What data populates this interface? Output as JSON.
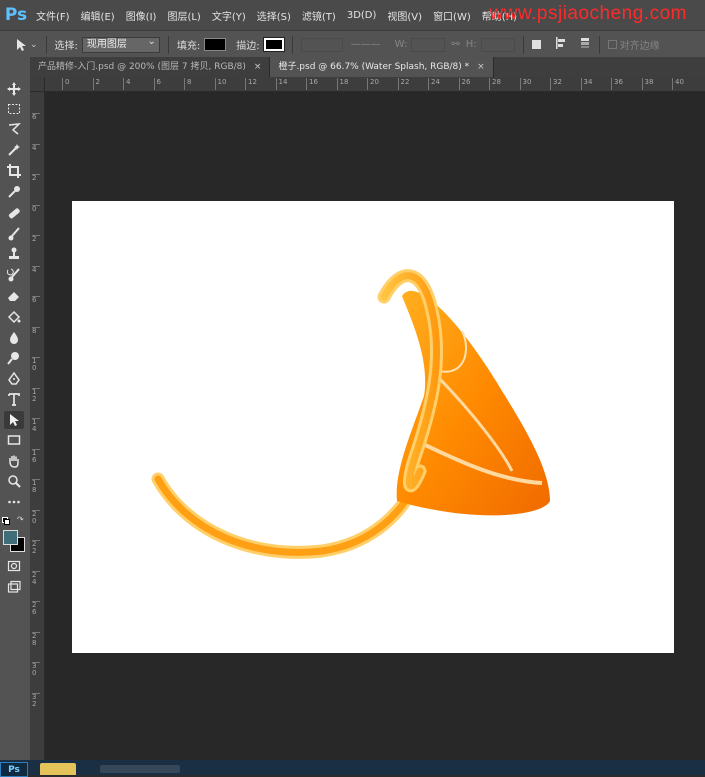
{
  "app": {
    "logo": "Ps"
  },
  "menu": [
    "文件(F)",
    "编辑(E)",
    "图像(I)",
    "图层(L)",
    "文字(Y)",
    "选择(S)",
    "滤镜(T)",
    "3D(D)",
    "视图(V)",
    "窗口(W)",
    "帮助(H)"
  ],
  "watermark": "www.psjiaocheng.com",
  "options": {
    "select_label": "选择:",
    "select_value": "现用图层",
    "fill_label": "填充:",
    "stroke_label": "描边:",
    "w_label": "W:",
    "h_label": "H:",
    "align_edges": "对齐边缘",
    "fill_color": "#000000"
  },
  "tabs": [
    {
      "label": "产品精修-入门.psd @ 200% (图层 7 拷贝, RGB/8)",
      "close": "×"
    },
    {
      "label": "橙子.psd @ 66.7% (Water Splash, RGB/8) *",
      "close": "×"
    }
  ],
  "ruler_top": [
    "0",
    "2",
    "4",
    "6",
    "8",
    "10",
    "12",
    "14",
    "16",
    "18",
    "20",
    "22",
    "24",
    "26",
    "28",
    "30",
    "32",
    "34",
    "36",
    "38",
    "40"
  ],
  "ruler_left": [
    "6",
    "4",
    "2",
    "0",
    "2",
    "4",
    "6",
    "8",
    "10",
    "12",
    "14",
    "16",
    "18",
    "20",
    "22",
    "24",
    "26",
    "28",
    "30",
    "32"
  ],
  "tools": [
    "move-icon",
    "marquee-icon",
    "lasso-icon",
    "magic-wand-icon",
    "crop-icon",
    "eyedropper-icon",
    "healing-brush-icon",
    "brush-icon",
    "clone-stamp-icon",
    "history-brush-icon",
    "eraser-icon",
    "paint-bucket-icon",
    "blur-icon",
    "dodge-icon",
    "pen-icon",
    "type-icon",
    "path-selection-icon",
    "rectangle-icon",
    "hand-icon",
    "zoom-icon",
    "more-tools-icon"
  ],
  "colors": {
    "foreground": "#3f6e78",
    "background": "#000000",
    "accent": "#5ec0ff"
  },
  "taskbar": {
    "ps_label": "Ps"
  }
}
